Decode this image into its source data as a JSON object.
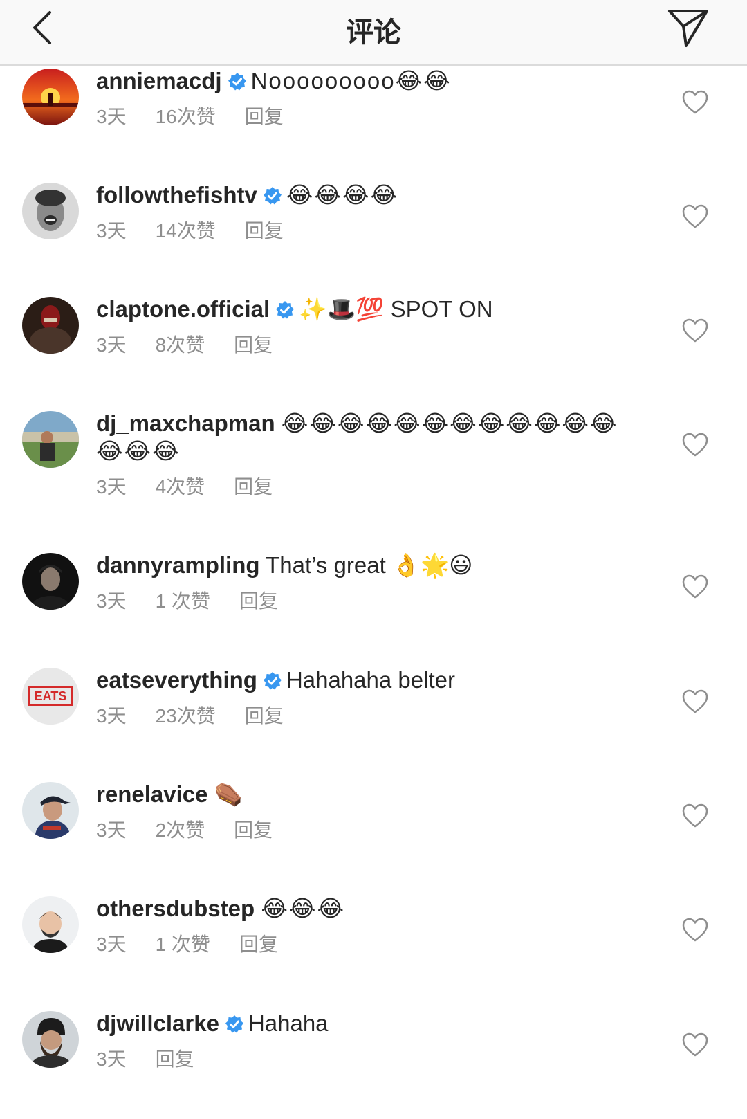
{
  "header": {
    "title": "评论"
  },
  "colors": {
    "verified": "#3897f0",
    "meta": "#8e8e8e",
    "text": "#262626"
  },
  "comments": [
    {
      "username": "anniemacdj",
      "verified": true,
      "text": "Nooooooooo😂😂",
      "time": "3天",
      "likes": "16次赞",
      "reply": "回复",
      "avatar": "sunset"
    },
    {
      "username": "followthefishtv",
      "verified": true,
      "text": "😂😂😂😂",
      "time": "3天",
      "likes": "14次赞",
      "reply": "回复",
      "avatar": "face-bw"
    },
    {
      "username": "claptone.official",
      "verified": true,
      "text": "✨🎩💯 SPOT ON",
      "time": "3天",
      "likes": "8次赞",
      "reply": "回复",
      "avatar": "mask"
    },
    {
      "username": "dj_maxchapman",
      "verified": false,
      "text": "😂😂😂😂😂😂😂😂😂😂😂😂😂😂😂",
      "time": "3天",
      "likes": "4次赞",
      "reply": "回复",
      "avatar": "outdoor"
    },
    {
      "username": "dannyrampling",
      "verified": false,
      "text": "That’s great 👌🌟😃",
      "time": "3天",
      "likes": "1 次赞",
      "reply": "回复",
      "avatar": "dark-portrait"
    },
    {
      "username": "eatseverything",
      "verified": true,
      "text": "Hahahaha belter",
      "time": "3天",
      "likes": "23次赞",
      "reply": "回复",
      "avatar": "eats-logo",
      "avatar_text": "EATS"
    },
    {
      "username": "renelavice",
      "verified": false,
      "text": "⚰️",
      "time": "3天",
      "likes": "2次赞",
      "reply": "回复",
      "avatar": "cap"
    },
    {
      "username": "othersdubstep",
      "verified": false,
      "text": "😂😂😂",
      "time": "3天",
      "likes": "1 次赞",
      "reply": "回复",
      "avatar": "cartoon"
    },
    {
      "username": "djwillclarke",
      "verified": true,
      "text": "Hahaha",
      "time": "3天",
      "likes": "",
      "reply": "回复",
      "avatar": "beanie"
    }
  ]
}
